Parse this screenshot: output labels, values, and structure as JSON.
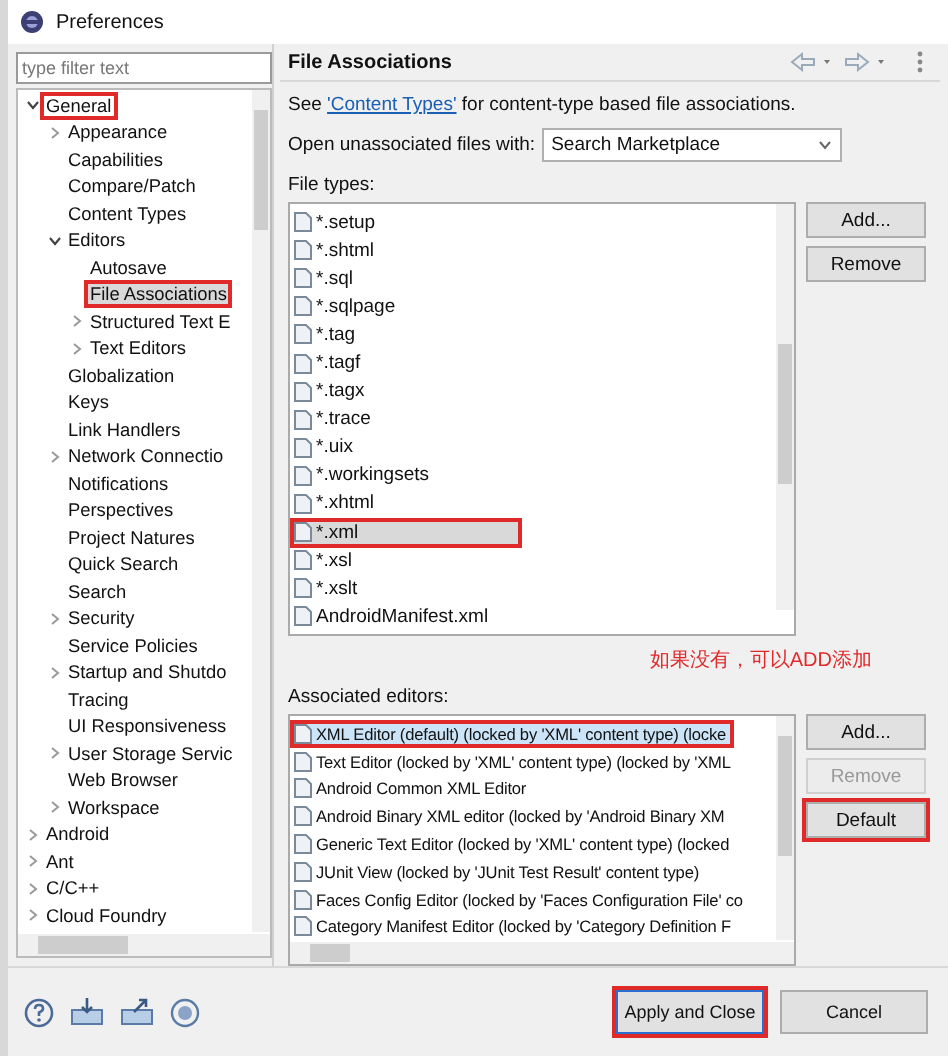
{
  "window": {
    "title": "Preferences"
  },
  "filter": {
    "placeholder": "type filter text"
  },
  "tree": [
    {
      "label": "General",
      "expanded": true,
      "selected": false,
      "annotated": true,
      "children": [
        {
          "label": "Appearance",
          "expanded": false,
          "selected": false
        },
        {
          "label": "Capabilities",
          "selected": false
        },
        {
          "label": "Compare/Patch",
          "selected": false
        },
        {
          "label": "Content Types",
          "selected": false
        },
        {
          "label": "Editors",
          "expanded": true,
          "selected": false,
          "children": [
            {
              "label": "Autosave",
              "selected": false
            },
            {
              "label": "File Associations",
              "selected": true,
              "annotated": true
            },
            {
              "label": "Structured Text E",
              "expanded": false,
              "selected": false
            },
            {
              "label": "Text Editors",
              "expanded": false,
              "selected": false
            }
          ]
        },
        {
          "label": "Globalization",
          "selected": false
        },
        {
          "label": "Keys",
          "selected": false
        },
        {
          "label": "Link Handlers",
          "selected": false
        },
        {
          "label": "Network Connectio",
          "expanded": false,
          "selected": false
        },
        {
          "label": "Notifications",
          "selected": false
        },
        {
          "label": "Perspectives",
          "selected": false
        },
        {
          "label": "Project Natures",
          "selected": false
        },
        {
          "label": "Quick Search",
          "selected": false
        },
        {
          "label": "Search",
          "selected": false
        },
        {
          "label": "Security",
          "expanded": false,
          "selected": false
        },
        {
          "label": "Service Policies",
          "selected": false
        },
        {
          "label": "Startup and Shutdo",
          "expanded": false,
          "selected": false
        },
        {
          "label": "Tracing",
          "selected": false
        },
        {
          "label": "UI Responsiveness",
          "selected": false
        },
        {
          "label": "User Storage Servic",
          "expanded": false,
          "selected": false
        },
        {
          "label": "Web Browser",
          "selected": false
        },
        {
          "label": "Workspace",
          "expanded": false,
          "selected": false
        }
      ]
    },
    {
      "label": "Android",
      "expanded": false,
      "selected": false
    },
    {
      "label": "Ant",
      "expanded": false,
      "selected": false
    },
    {
      "label": "C/C++",
      "expanded": false,
      "selected": false
    },
    {
      "label": "Cloud Foundry",
      "expanded": false,
      "selected": false
    }
  ],
  "page": {
    "title": "File Associations",
    "intro": {
      "before": "See ",
      "link": "'Content Types'",
      "after": " for content-type based file associations."
    },
    "open_with": {
      "label": "Open unassociated files with:",
      "value": "Search Marketplace"
    },
    "file_types_label": "File types:",
    "file_types": [
      {
        "name": "*.setup",
        "selected": false
      },
      {
        "name": "*.shtml",
        "selected": false
      },
      {
        "name": "*.sql",
        "selected": false
      },
      {
        "name": "*.sqlpage",
        "selected": false
      },
      {
        "name": "*.tag",
        "selected": false
      },
      {
        "name": "*.tagf",
        "selected": false
      },
      {
        "name": "*.tagx",
        "selected": false
      },
      {
        "name": "*.trace",
        "selected": false
      },
      {
        "name": "*.uix",
        "selected": false
      },
      {
        "name": "*.workingsets",
        "selected": false
      },
      {
        "name": "*.xhtml",
        "selected": false
      },
      {
        "name": "*.xml",
        "selected": true,
        "annotated": true
      },
      {
        "name": "*.xsl",
        "selected": false
      },
      {
        "name": "*.xslt",
        "selected": false
      },
      {
        "name": "AndroidManifest.xml",
        "selected": false
      }
    ],
    "file_type_buttons": [
      {
        "label": "Add...",
        "disabled": false
      },
      {
        "label": "Remove",
        "disabled": false
      }
    ],
    "note": "如果没有，可以ADD添加",
    "editors_label": "Associated editors:",
    "editors": [
      {
        "name": "XML Editor (default) (locked by 'XML' content type) (locke",
        "selected": true,
        "annotated": true
      },
      {
        "name": "Text Editor (locked by 'XML' content type) (locked by 'XML",
        "selected": false
      },
      {
        "name": "Android Common XML Editor",
        "selected": false
      },
      {
        "name": "Android Binary XML editor (locked by 'Android Binary XM",
        "selected": false
      },
      {
        "name": "Generic Text Editor (locked by 'XML' content type) (locked",
        "selected": false
      },
      {
        "name": "JUnit View (locked by 'JUnit Test Result' content type)",
        "selected": false
      },
      {
        "name": "Faces Config Editor (locked by 'Faces Configuration File' co",
        "selected": false
      },
      {
        "name": "Category Manifest Editor (locked by 'Category Definition F",
        "selected": false
      }
    ],
    "editor_buttons": [
      {
        "label": "Add...",
        "disabled": false,
        "annotated": false
      },
      {
        "label": "Remove",
        "disabled": true,
        "annotated": false
      },
      {
        "label": "Default",
        "disabled": false,
        "annotated": true
      }
    ]
  },
  "buttons": [
    {
      "label": "Apply and Close",
      "default": true,
      "annotated": true
    },
    {
      "label": "Cancel",
      "default": false,
      "annotated": false
    }
  ]
}
